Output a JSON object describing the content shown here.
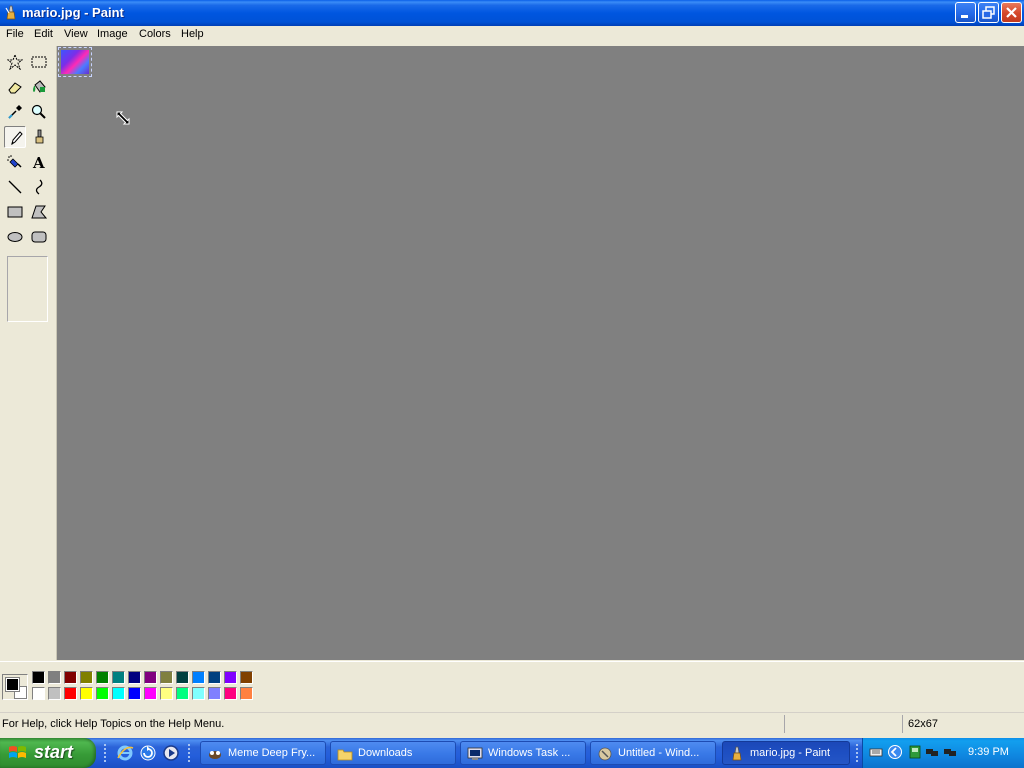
{
  "window": {
    "title": "mario.jpg - Paint",
    "controls": [
      "minimize",
      "restore",
      "close"
    ]
  },
  "menu": {
    "items": [
      "File",
      "Edit",
      "View",
      "Image",
      "Colors",
      "Help"
    ]
  },
  "tools": [
    {
      "name": "free-form-select",
      "icon": "star-select-icon"
    },
    {
      "name": "select",
      "icon": "rect-select-icon"
    },
    {
      "name": "eraser",
      "icon": "eraser-icon"
    },
    {
      "name": "fill-with-color",
      "icon": "paint-bucket-icon"
    },
    {
      "name": "pick-color",
      "icon": "eyedropper-icon"
    },
    {
      "name": "magnifier",
      "icon": "magnifier-icon"
    },
    {
      "name": "pencil",
      "icon": "pencil-icon",
      "selected": true
    },
    {
      "name": "brush",
      "icon": "brush-icon"
    },
    {
      "name": "airbrush",
      "icon": "airbrush-icon"
    },
    {
      "name": "text",
      "icon": "text-icon",
      "glyph": "A"
    },
    {
      "name": "line",
      "icon": "line-icon"
    },
    {
      "name": "curve",
      "icon": "curve-icon"
    },
    {
      "name": "rectangle",
      "icon": "rectangle-icon"
    },
    {
      "name": "polygon",
      "icon": "polygon-icon"
    },
    {
      "name": "ellipse",
      "icon": "ellipse-icon"
    },
    {
      "name": "rounded-rectangle",
      "icon": "rounded-rectangle-icon"
    }
  ],
  "palette": {
    "foreground": "#000000",
    "background": "#ffffff",
    "top_row": [
      "#000000",
      "#808080",
      "#800000",
      "#808000",
      "#008000",
      "#008080",
      "#000080",
      "#800080",
      "#808040",
      "#004040",
      "#0080ff",
      "#004080",
      "#8000ff",
      "#804000"
    ],
    "bottom_row": [
      "#ffffff",
      "#c0c0c0",
      "#ff0000",
      "#ffff00",
      "#00ff00",
      "#00ffff",
      "#0000ff",
      "#ff00ff",
      "#ffff80",
      "#00ff80",
      "#80ffff",
      "#8080ff",
      "#ff0080",
      "#ff8040"
    ]
  },
  "canvas": {
    "workspace_color": "#808080",
    "image_size": "62x67"
  },
  "status": {
    "help_text": "For Help, click Help Topics on the Help Menu.",
    "size": "62x67"
  },
  "taskbar": {
    "start_label": "start",
    "quick_launch": [
      "internet-explorer-icon",
      "refresh-icon",
      "media-player-icon"
    ],
    "tasks": [
      {
        "label": "Meme Deep Fry...",
        "icon": "app-icon",
        "active": false
      },
      {
        "label": "Downloads",
        "icon": "folder-icon",
        "active": false
      },
      {
        "label": "Windows Task ...",
        "icon": "task-manager-icon",
        "active": false
      },
      {
        "label": "Untitled - Wind...",
        "icon": "window-icon",
        "active": false
      },
      {
        "label": "mario.jpg - Paint",
        "icon": "paint-icon",
        "active": true
      }
    ],
    "tray_icons": [
      "keyboard-icon",
      "back-arrow-icon",
      "green-app-icon",
      "network-icon",
      "network-icon"
    ],
    "clock": "9:39 PM"
  }
}
